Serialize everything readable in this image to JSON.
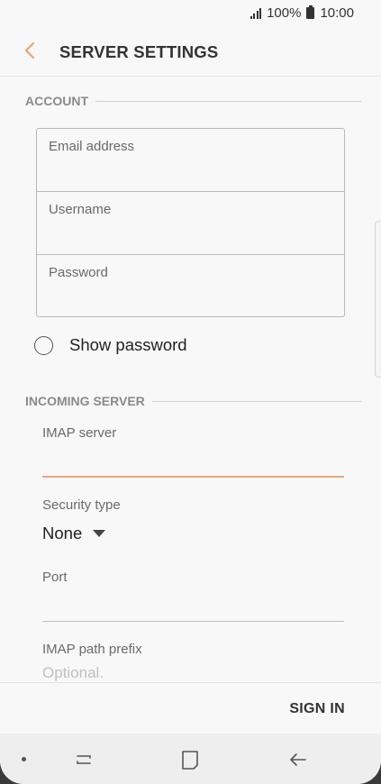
{
  "status_bar": {
    "battery": "100%",
    "time": "10:00"
  },
  "header": {
    "title": "SERVER SETTINGS",
    "back_icon": "chevron-left-icon"
  },
  "account": {
    "section_label": "ACCOUNT",
    "email_label": "Email address",
    "username_label": "Username",
    "password_label": "Password",
    "show_password_label": "Show password"
  },
  "incoming": {
    "section_label": "INCOMING SERVER",
    "imap_server_label": "IMAP server",
    "security_type_label": "Security type",
    "security_type_value": "None",
    "port_label": "Port",
    "imap_path_label": "IMAP path prefix",
    "imap_path_placeholder": "Optional."
  },
  "actions": {
    "sign_in_label": "SIGN IN"
  },
  "colors": {
    "accent": "#e9a37a",
    "background": "#f8f8f8",
    "text": "#333333"
  },
  "nav_icons": [
    "recent-apps-icon",
    "home-icon",
    "back-arrow-icon"
  ]
}
